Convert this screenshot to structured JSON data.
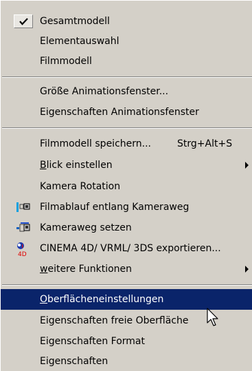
{
  "menu": {
    "items": [
      {
        "label": "Gesamtmodell",
        "checked": true
      },
      {
        "label": "Elementauswahl"
      },
      {
        "label": "Filmmodell"
      },
      {
        "label": "Größe Animationsfenster..."
      },
      {
        "label": "Eigenschaften Animationsfenster"
      },
      {
        "label": "Filmmodell speichern...",
        "shortcut": "Strg+Alt+S"
      },
      {
        "label_prefix": "",
        "label_mnemonic": "B",
        "label_rest": "lick einstellen",
        "submenu": true
      },
      {
        "label": "Kamera Rotation"
      },
      {
        "label": "Filmablauf entlang Kameraweg",
        "icon": "camera-path-icon"
      },
      {
        "label": "Kameraweg setzen",
        "icon": "camera-set-icon"
      },
      {
        "label": "CINEMA 4D/ VRML/ 3DS exportieren...",
        "icon": "cinema4d-export-icon"
      },
      {
        "label_prefix": "",
        "label_mnemonic": "w",
        "label_rest": "eitere Funktionen",
        "submenu": true
      },
      {
        "label_prefix": "",
        "label_mnemonic": "O",
        "label_rest": "berflächeneinstellungen",
        "selected": true
      },
      {
        "label": "Eigenschaften freie Oberfläche"
      },
      {
        "label": "Eigenschaften Format"
      },
      {
        "label": "Eigenschaften"
      }
    ]
  },
  "colors": {
    "menu_background": "#d4d0c8",
    "selection_background": "#0a246a",
    "selection_text": "#ffffff",
    "text": "#000000",
    "separator_dark": "#808080",
    "separator_light": "#ffffff"
  }
}
